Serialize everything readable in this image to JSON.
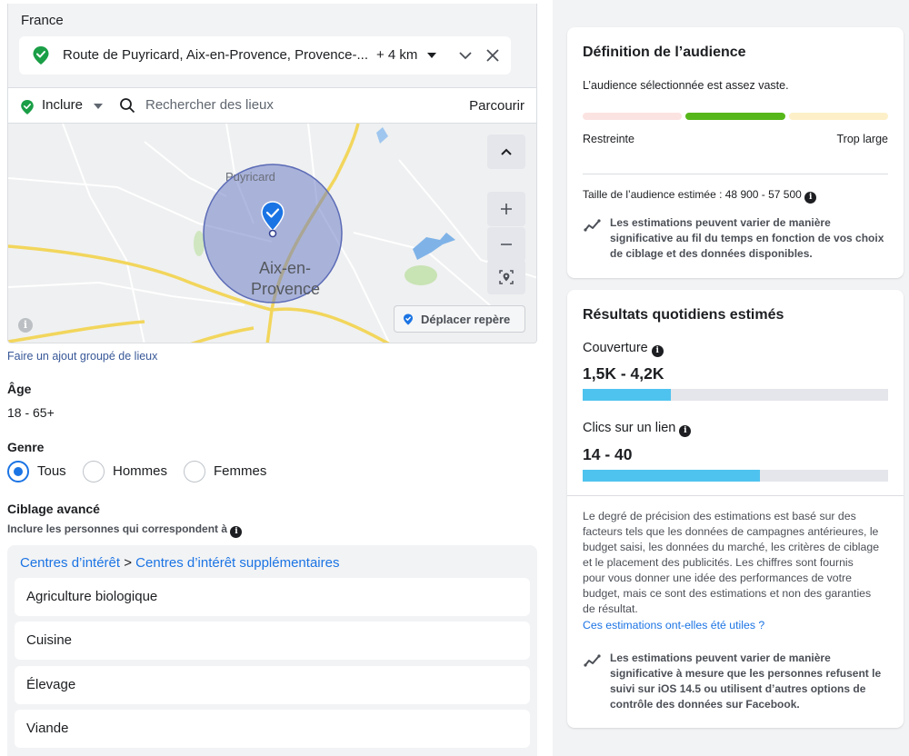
{
  "location": {
    "country": "France",
    "address": "Route de Puyricard, Aix-en-Provence, Provence-...",
    "radius": "+ 4 km",
    "include_label": "Inclure",
    "search_placeholder": "Rechercher des lieux",
    "browse_label": "Parcourir"
  },
  "map": {
    "place_puyricard": "Puyricard",
    "place_aix_line1": "Aix-en-",
    "place_aix_line2": "Provence",
    "move_pin_label": "Déplacer repère",
    "info_glyph": "i"
  },
  "bulk_add_link": "Faire un ajout groupé de lieux",
  "age": {
    "title": "Âge",
    "value": "18 - 65+"
  },
  "gender": {
    "title": "Genre",
    "options": [
      "Tous",
      "Hommes",
      "Femmes"
    ],
    "selected": "Tous"
  },
  "advanced": {
    "title": "Ciblage avancé",
    "subtitle": "Inclure les personnes qui correspondent à",
    "breadcrumb_1": "Centres d’intérêt",
    "breadcrumb_sep": ">",
    "breadcrumb_2": "Centres d’intérêt supplémentaires",
    "items": [
      "Agriculture biologique",
      "Cuisine",
      "Élevage",
      "Viande"
    ]
  },
  "audience": {
    "title": "Définition de l’audience",
    "description": "L’audience sélectionnée est assez vaste.",
    "left_label": "Restreinte",
    "right_label": "Trop large",
    "size_text": "Taille de l’audience estimée : 48 900 - 57 500",
    "note_line1": "Les estimations peuvent varier de manière",
    "note_line2": "significative au fil du temps en fonction de vos choix",
    "note_line3": "de ciblage et des données disponibles."
  },
  "daily": {
    "title": "Résultats quotidiens estimés",
    "reach_label": "Couverture",
    "reach_value": "1,5K - 4,2K",
    "reach_fill": 0.29,
    "clicks_label": "Clics sur un lien",
    "clicks_value": "14 - 40",
    "clicks_fill": 0.58,
    "explain_lines": [
      "Le degré de précision des estimations est basé sur des",
      "facteurs tels que les données de campagnes antérieures, le",
      "budget saisi, les données du marché, les critères de ciblage",
      "et le placement des publicités. Les chiffres sont fournis",
      "pour vous donner une idée des performances de votre",
      "budget, mais ce sont des estimations et non des garanties",
      "de résultat."
    ],
    "helpful_link": "Ces estimations ont-elles été utiles ?",
    "note_line1": "Les estimations peuvent varier de manière",
    "note_line2": "significative à mesure que les personnes refusent le",
    "note_line3": "suivi sur iOS 14.5 ou utilisent d’autres options de",
    "note_line4": "contrôle des données sur Facebook."
  },
  "colors": {
    "accent": "#1b74e4",
    "green": "#42b72a",
    "seg_low": "#fbe3e1",
    "seg_mid": "#56b71a",
    "seg_high": "#fdf0c9",
    "bar_fill": "#4fc3ef"
  }
}
